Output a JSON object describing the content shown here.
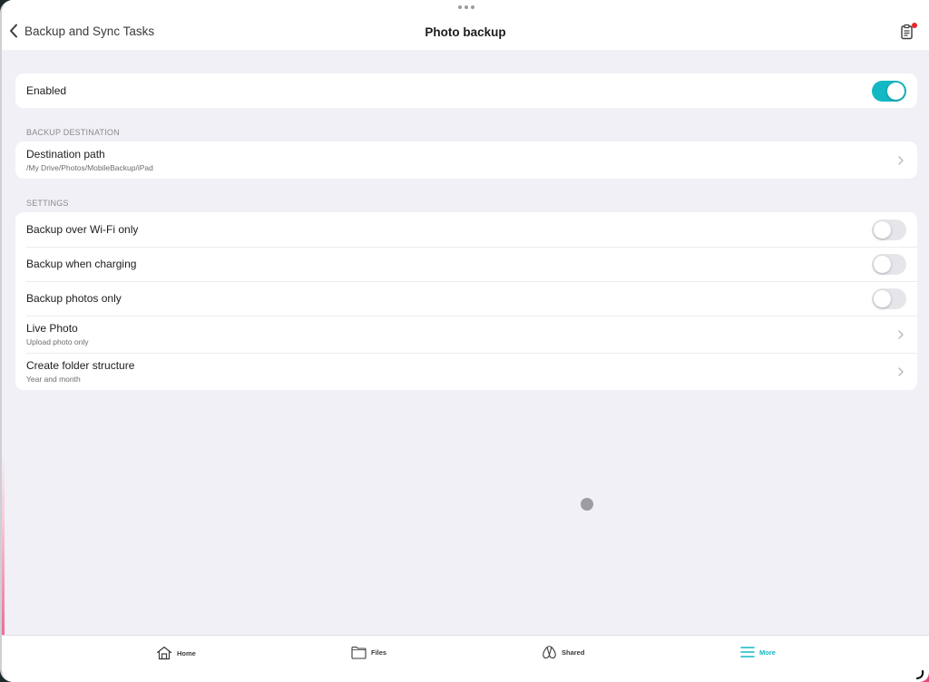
{
  "navbar": {
    "back_label": "Backup and Sync Tasks",
    "title": "Photo backup",
    "task_icon": "clipboard-icon",
    "has_notification": true
  },
  "enabled": {
    "label": "Enabled",
    "value": true
  },
  "backup_destination": {
    "header": "BACKUP DESTINATION",
    "destination": {
      "label": "Destination path",
      "value": "/My Drive/Photos/MobileBackup/iPad"
    }
  },
  "settings": {
    "header": "SETTINGS",
    "toggles": [
      {
        "label": "Backup over Wi-Fi only",
        "value": false
      },
      {
        "label": "Backup when charging",
        "value": false
      },
      {
        "label": "Backup photos only",
        "value": false
      }
    ],
    "links": [
      {
        "label": "Live Photo",
        "value": "Upload photo only"
      },
      {
        "label": "Create folder structure",
        "value": "Year and month"
      }
    ]
  },
  "tabbar": {
    "items": [
      {
        "label": "Home",
        "icon": "home-icon",
        "active": false
      },
      {
        "label": "Files",
        "icon": "folder-icon",
        "active": false
      },
      {
        "label": "Shared",
        "icon": "shared-icon",
        "active": false
      },
      {
        "label": "More",
        "icon": "menu-icon",
        "active": true
      }
    ]
  },
  "colors": {
    "accent": "#14b8c4",
    "background": "#f1f0f6",
    "card": "#ffffff",
    "notification": "#e8262b"
  }
}
